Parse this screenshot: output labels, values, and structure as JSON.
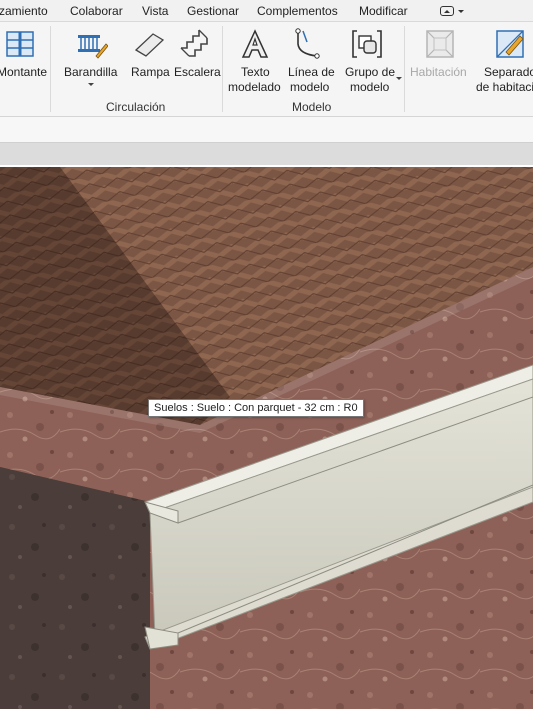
{
  "menubar": {
    "items": [
      "zamiento",
      "Colaborar",
      "Vista",
      "Gestionar",
      "Complementos",
      "Modificar"
    ]
  },
  "ribbon": {
    "buttons": {
      "montante": "Montante",
      "barandilla": "Barandilla",
      "rampa": "Rampa",
      "escalera": "Escalera",
      "texto_modelado_1": "Texto",
      "texto_modelado_2": "modelado",
      "linea_modelo_1": "Línea de",
      "linea_modelo_2": "modelo",
      "grupo_modelo_1": "Grupo de",
      "grupo_modelo_2": "modelo",
      "habitacion": "Habitación",
      "separador_1": "Separado",
      "separador_2": "de habitaci"
    },
    "panels": {
      "circulacion": "Circulación",
      "modelo": "Modelo"
    }
  },
  "viewport": {
    "tooltip": "Suelos : Suelo : Con parquet - 32 cm : R0"
  },
  "colors": {
    "parquet": "#7a5442",
    "marble": "#8a5e54",
    "wall": "#5a4a46",
    "beam": "#d4d3c6"
  }
}
